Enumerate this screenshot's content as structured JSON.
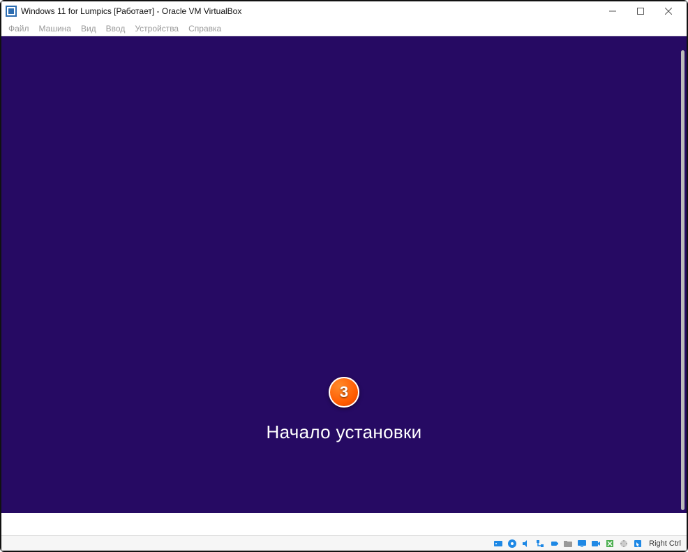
{
  "titlebar": {
    "title": "Windows 11 for Lumpics [Работает] - Oracle VM VirtualBox"
  },
  "menubar": {
    "items": [
      "Файл",
      "Машина",
      "Вид",
      "Ввод",
      "Устройства",
      "Справка"
    ]
  },
  "vm": {
    "step_number": "3",
    "install_text": "Начало установки"
  },
  "statusbar": {
    "host_key": "Right Ctrl",
    "icons": [
      "hard-disk-icon",
      "optical-disc-icon",
      "audio-icon",
      "network-icon",
      "usb-icon",
      "shared-folders-icon",
      "display-icon",
      "recording-icon",
      "guest-additions-icon",
      "processor-icon",
      "mouse-integration-icon"
    ]
  }
}
